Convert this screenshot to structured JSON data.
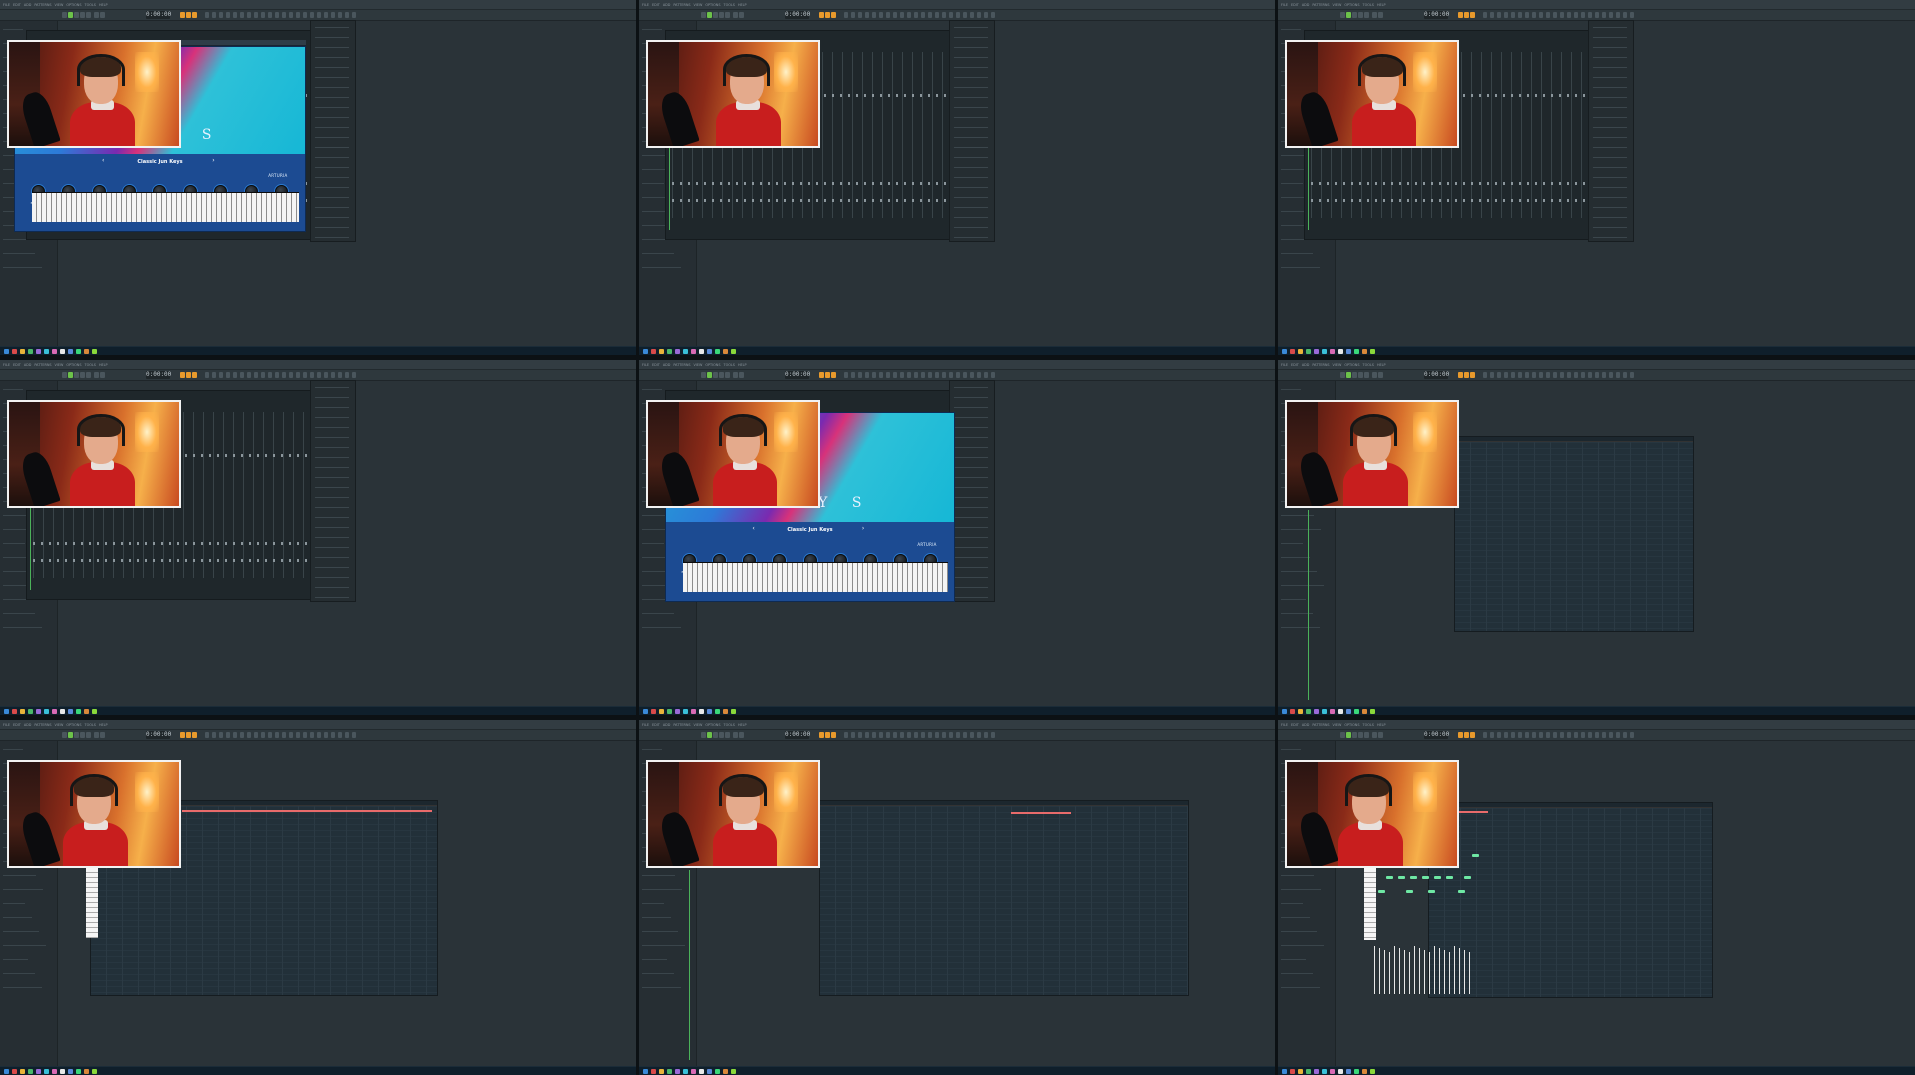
{
  "app": {
    "menu": [
      "FILE",
      "EDIT",
      "ADD",
      "PATTERNS",
      "VIEW",
      "OPTIONS",
      "TOOLS",
      "HELP"
    ],
    "time_display": "0:00:00",
    "tempo_mode": "PAT"
  },
  "plugin": {
    "header_title": "ANALOG LAB PRO",
    "preset_name": "Classic Jun Keys",
    "brand": "ARTURIA",
    "keys_title": "K E Y S",
    "knobs": [
      "Brightness",
      "Timbre",
      "Time",
      "Movement",
      "Distortion Mix",
      "Phaser Mix",
      "Delay Volume",
      "Reverb Volume",
      "Master"
    ]
  },
  "colors": {
    "accent_orange": "#e89a2c",
    "accent_green": "#6cc24a",
    "note_green": "#6ee8a4",
    "taskbar": "#0f1f2b"
  },
  "panels": [
    {
      "id": 1,
      "view": "plugin"
    },
    {
      "id": 2,
      "view": "mixer"
    },
    {
      "id": 3,
      "view": "mixer"
    },
    {
      "id": 4,
      "view": "mixer"
    },
    {
      "id": 5,
      "view": "plugin"
    },
    {
      "id": 6,
      "view": "playlist"
    },
    {
      "id": 7,
      "view": "piano-roll"
    },
    {
      "id": 8,
      "view": "piano-roll"
    },
    {
      "id": 9,
      "view": "piano-roll"
    }
  ]
}
